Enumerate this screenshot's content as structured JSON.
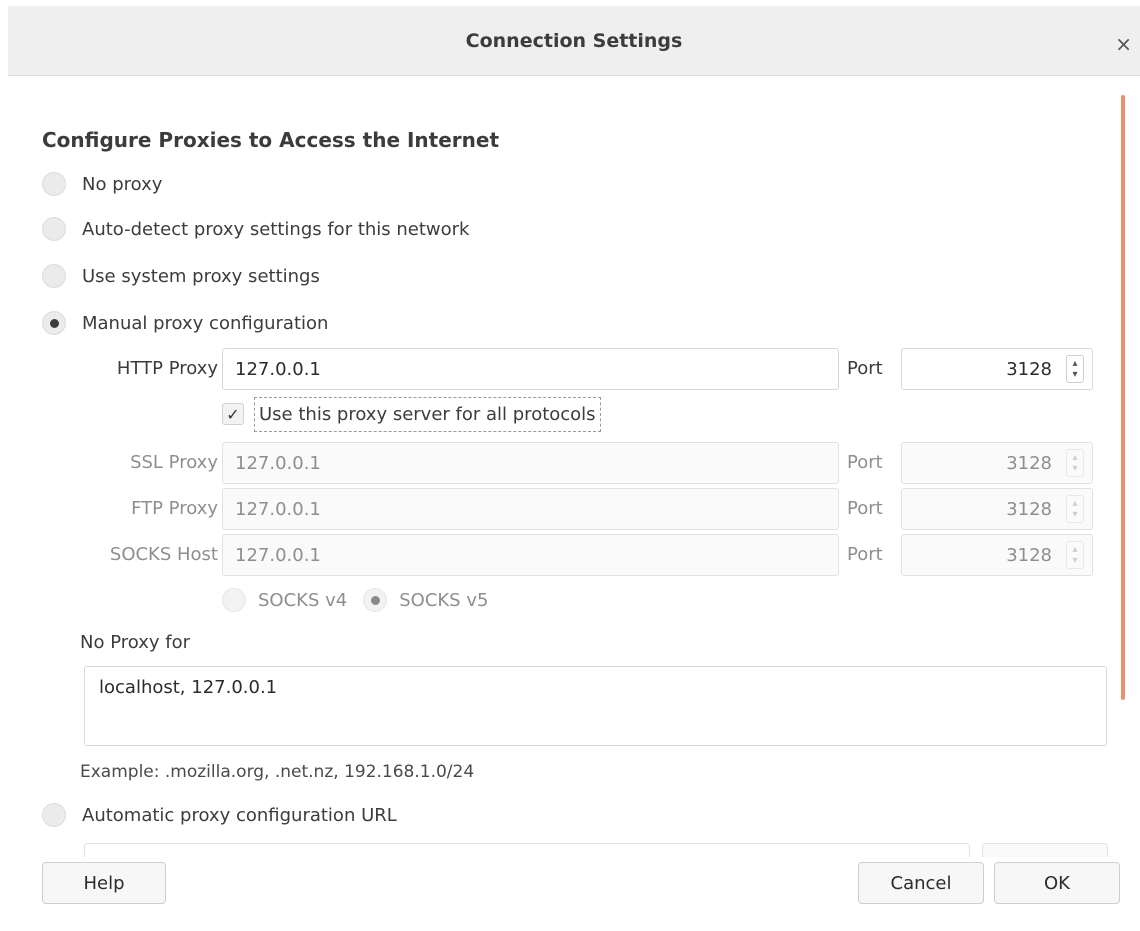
{
  "window": {
    "title": "Connection Settings",
    "close_glyph": "×"
  },
  "heading": "Configure Proxies to Access the Internet",
  "options": {
    "no_proxy": "No proxy",
    "auto_detect": "Auto-detect proxy settings for this network",
    "system": "Use system proxy settings",
    "manual": "Manual proxy configuration",
    "auto_url": "Automatic proxy configuration URL"
  },
  "selected_option": "manual",
  "http": {
    "label": "HTTP Proxy",
    "value": "127.0.0.1",
    "port_label": "Port",
    "port": "3128"
  },
  "share_checkbox": {
    "label": "Use this proxy server for all protocols",
    "checked": true
  },
  "ssl": {
    "label": "SSL Proxy",
    "value": "127.0.0.1",
    "port_label": "Port",
    "port": "3128"
  },
  "ftp": {
    "label": "FTP Proxy",
    "value": "127.0.0.1",
    "port_label": "Port",
    "port": "3128"
  },
  "socks": {
    "label": "SOCKS Host",
    "value": "127.0.0.1",
    "port_label": "Port",
    "port": "3128",
    "v4_label": "SOCKS v4",
    "v5_label": "SOCKS v5",
    "selected": "v5"
  },
  "no_proxy_for": {
    "label": "No Proxy for",
    "value": "localhost, 127.0.0.1",
    "example": "Example: .mozilla.org, .net.nz, 192.168.1.0/24"
  },
  "buttons": {
    "help": "Help",
    "cancel": "Cancel",
    "ok": "OK"
  },
  "colors": {
    "scroll_accent": "#e8926b",
    "titlebar_bg": "#efefef"
  }
}
